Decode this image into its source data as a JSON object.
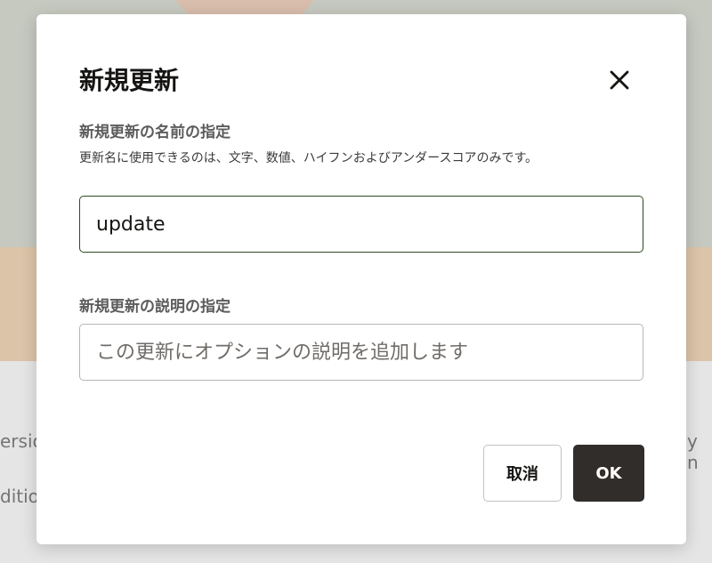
{
  "background": {
    "text_left_1": "ersio",
    "text_left_2": "ditio",
    "text_right_1": "y n"
  },
  "modal": {
    "title": "新規更新",
    "close_icon": "close-icon",
    "name_field": {
      "label": "新規更新の名前の指定",
      "help": "更新名に使用できるのは、文字、数値、ハイフンおよびアンダースコアのみです。",
      "value": "update"
    },
    "description_field": {
      "label": "新規更新の説明の指定",
      "placeholder": "この更新にオプションの説明を追加します",
      "value": ""
    },
    "buttons": {
      "cancel_label": "取消",
      "ok_label": "OK"
    }
  },
  "colors": {
    "primary_button": "#312d2a",
    "active_input_border": "#2e4a1f",
    "input_border": "#b8b6b3"
  }
}
